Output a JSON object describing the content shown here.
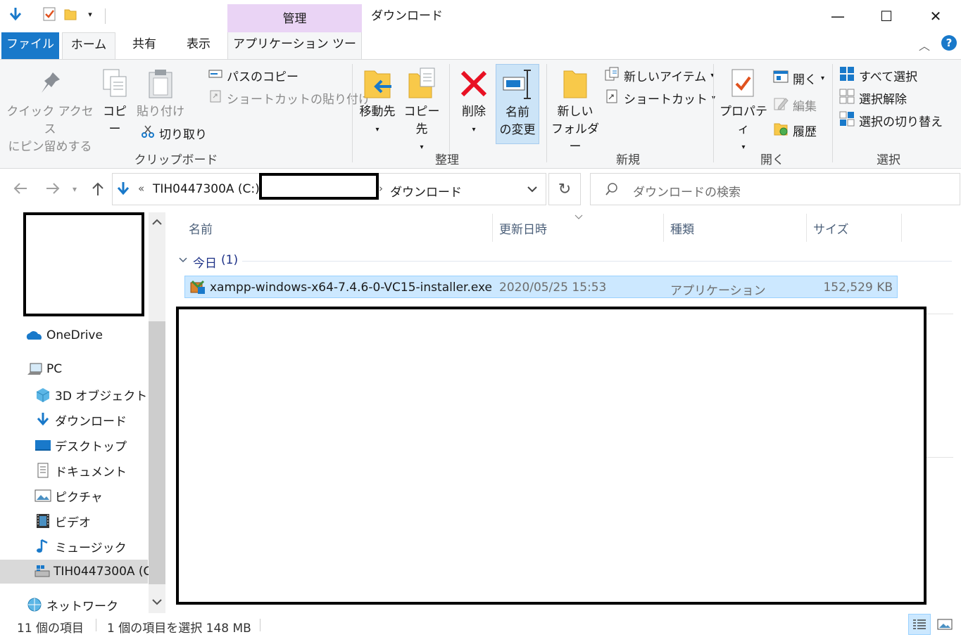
{
  "window": {
    "title": "ダウンロード",
    "context_header": "管理",
    "minimize": "—",
    "maximize": "☐",
    "close": "✕"
  },
  "tabs": {
    "file": "ファイル",
    "home": "ホーム",
    "share": "共有",
    "view": "表示",
    "app_tools": "アプリケーション ツール"
  },
  "ribbon": {
    "pin_label_1": "クイック アクセス",
    "pin_label_2": "にピン留めする",
    "copy": "コピー",
    "paste": "貼り付け",
    "copy_path": "パスのコピー",
    "paste_shortcut": "ショートカットの貼り付け",
    "cut": "切り取り",
    "group_clipboard": "クリップボード",
    "move_to": "移動先",
    "copy_to": "コピー先",
    "delete": "削除",
    "rename_1": "名前",
    "rename_2": "の変更",
    "group_organize": "整理",
    "new_folder_1": "新しい",
    "new_folder_2": "フォルダー",
    "new_item": "新しいアイテム",
    "shortcut": "ショートカット",
    "group_new": "新規",
    "properties": "プロパティ",
    "open": "開く",
    "edit": "編集",
    "history": "履歴",
    "group_open": "開く",
    "select_all": "すべて選択",
    "select_none": "選択解除",
    "invert_selection": "選択の切り替え",
    "group_select": "選択"
  },
  "address": {
    "chevron": "«",
    "drive": "TIH0447300A (C:)",
    "separator": "›",
    "current": "ダウンロード",
    "search_placeholder": "ダウンロードの検索"
  },
  "nav_pane": {
    "items": [
      {
        "label": "OneDrive",
        "icon": "onedrive-icon"
      },
      {
        "label": "PC",
        "icon": "pc-icon"
      },
      {
        "label": "3D オブジェクト",
        "icon": "3d-objects-icon"
      },
      {
        "label": "ダウンロード",
        "icon": "download-icon"
      },
      {
        "label": "デスクトップ",
        "icon": "desktop-icon"
      },
      {
        "label": "ドキュメント",
        "icon": "documents-icon"
      },
      {
        "label": "ピクチャ",
        "icon": "pictures-icon"
      },
      {
        "label": "ビデオ",
        "icon": "videos-icon"
      },
      {
        "label": "ミュージック",
        "icon": "music-icon"
      },
      {
        "label": "TIH0447300A (C",
        "icon": "drive-icon"
      },
      {
        "label": "ネットワーク",
        "icon": "network-icon"
      }
    ]
  },
  "list": {
    "columns": {
      "name": "名前",
      "modified": "更新日時",
      "type": "種類",
      "size": "サイズ"
    },
    "group": {
      "label": "今日",
      "count": "(1)"
    },
    "files": [
      {
        "name": "xampp-windows-x64-7.4.6-0-VC15-installer.exe",
        "modified": "2020/05/25 15:53",
        "type": "アプリケーション",
        "size": "152,529 KB"
      }
    ]
  },
  "status": {
    "item_count": "11 個の項目",
    "selection": "1 個の項目を選択  148 MB"
  },
  "colors": {
    "accent": "#1979ca",
    "context_tab": "#ead4f5",
    "selected_row": "#cce8ff",
    "selected_border": "#99d1ff",
    "delete_red": "#e81123"
  }
}
